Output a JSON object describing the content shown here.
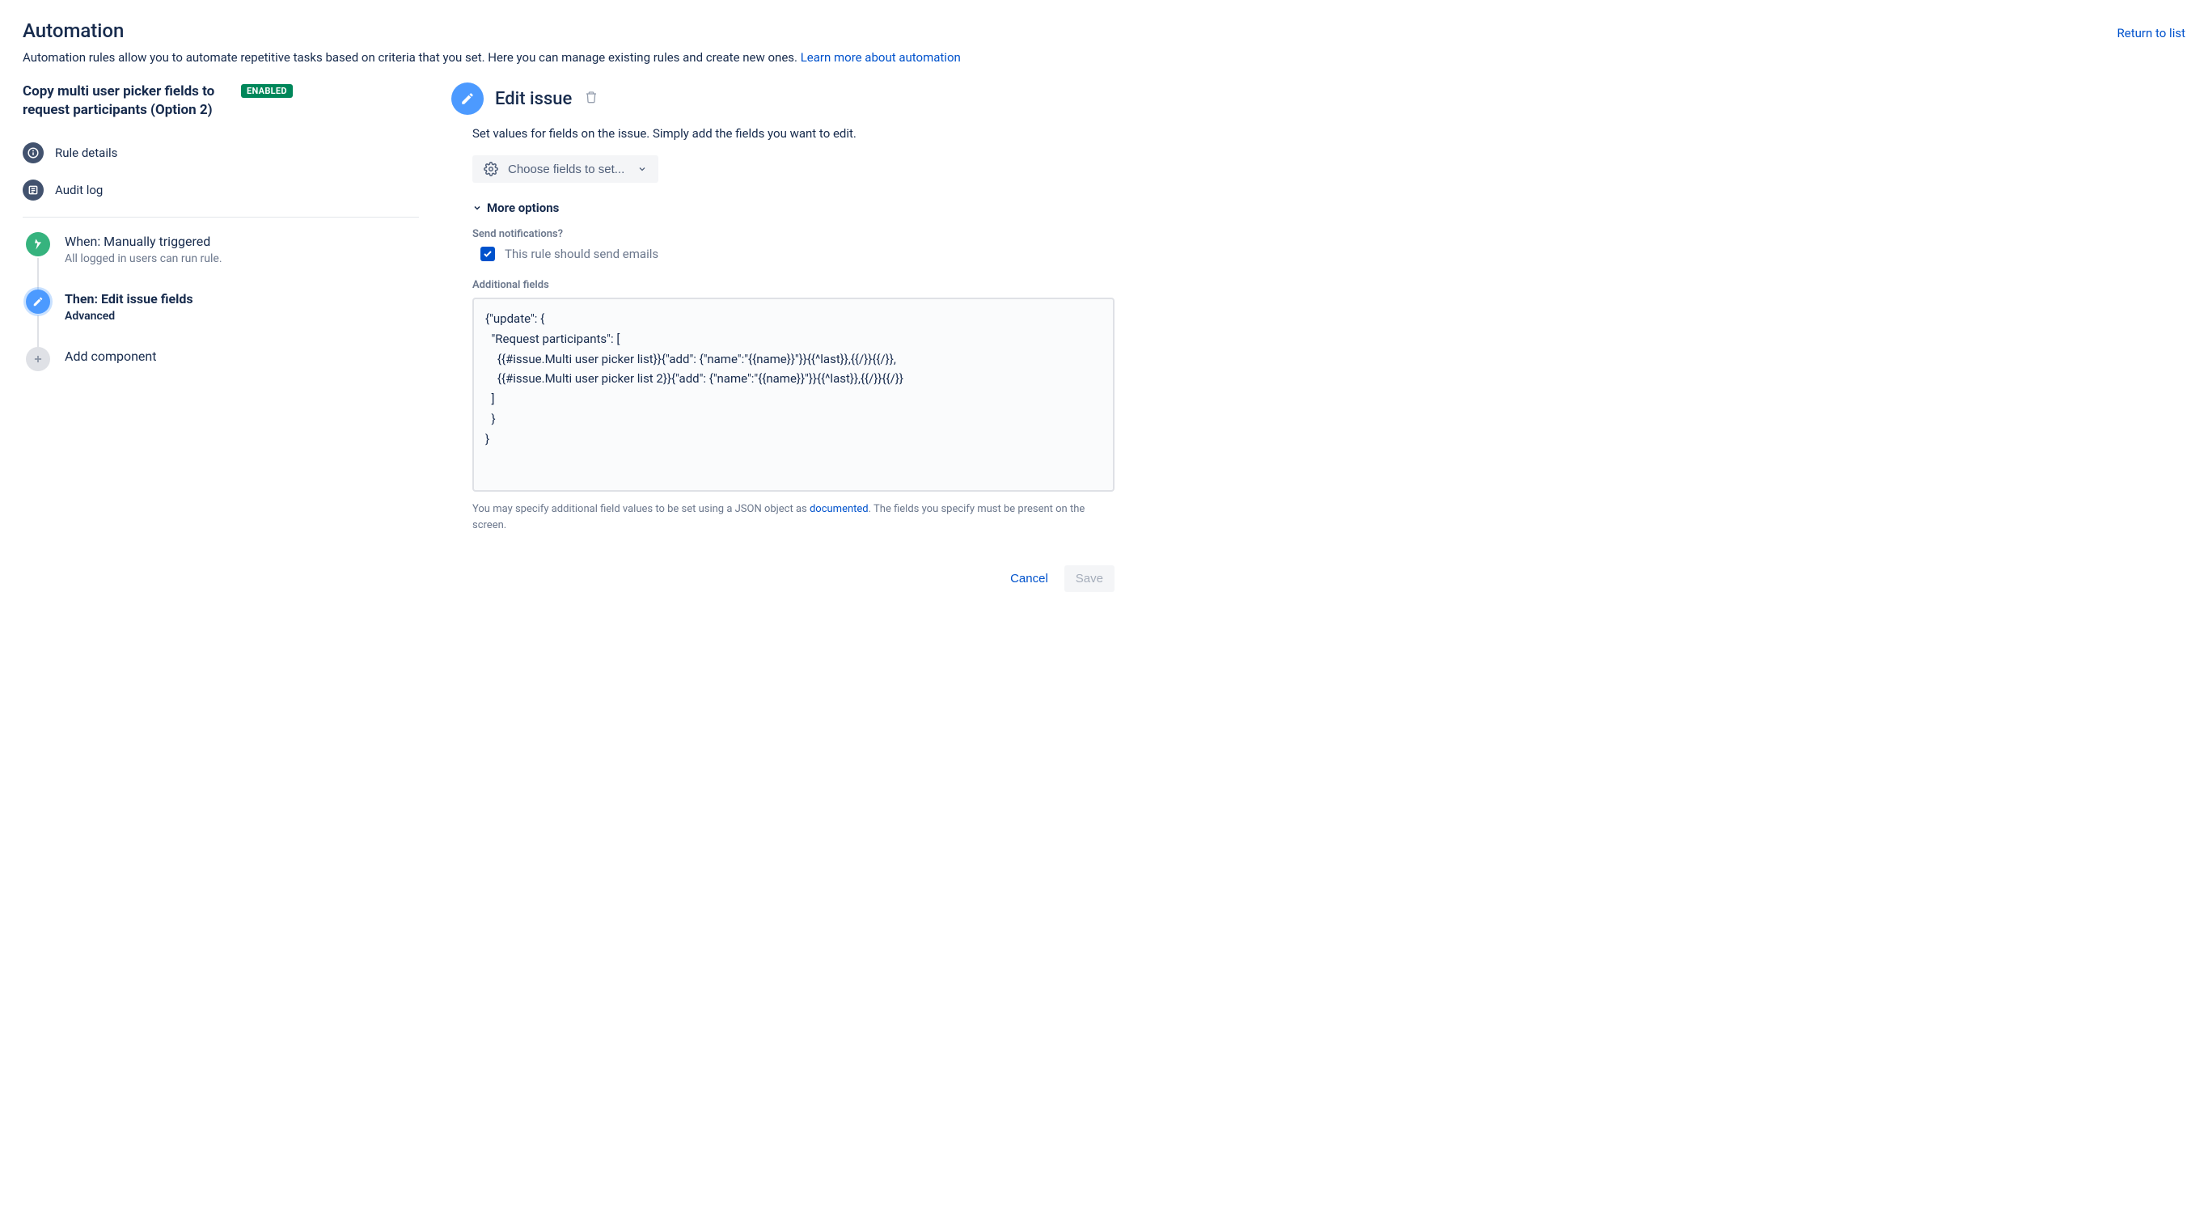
{
  "header": {
    "title": "Automation",
    "return_link": "Return to list",
    "intro_text": "Automation rules allow you to automate repetitive tasks based on criteria that you set. Here you can manage existing rules and create new ones. ",
    "intro_link": "Learn more about automation"
  },
  "sidebar": {
    "rule_name": "Copy multi user picker fields to request participants (Option 2)",
    "status_badge": "ENABLED",
    "nav": {
      "details": "Rule details",
      "audit": "Audit log"
    },
    "steps": {
      "trigger": {
        "title": "When: Manually triggered",
        "sub": "All logged in users can run rule."
      },
      "action": {
        "title": "Then: Edit issue fields",
        "sub": "Advanced"
      },
      "add": {
        "title": "Add component"
      }
    }
  },
  "panel": {
    "title": "Edit issue",
    "description": "Set values for fields on the issue. Simply add the fields you want to edit.",
    "choose_fields": "Choose fields to set...",
    "more_options": "More options",
    "notifications_label": "Send notifications?",
    "notifications_check": "This rule should send emails",
    "additional_label": "Additional fields",
    "json_value": "{\"update\": {\n  \"Request participants\": [\n    {{#issue.Multi user picker list}}{\"add\": {\"name\":\"{{name}}\"}}{{^last}},{{/}}{{/}},\n    {{#issue.Multi user picker list 2}}{\"add\": {\"name\":\"{{name}}\"}}{{^last}},{{/}}{{/}}\n  ]\n  }\n}",
    "help_pre": "You may specify additional field values to be set using a JSON object as ",
    "help_link": "documented",
    "help_post": ". The fields you specify must be present on the screen.",
    "cancel": "Cancel",
    "save": "Save"
  }
}
